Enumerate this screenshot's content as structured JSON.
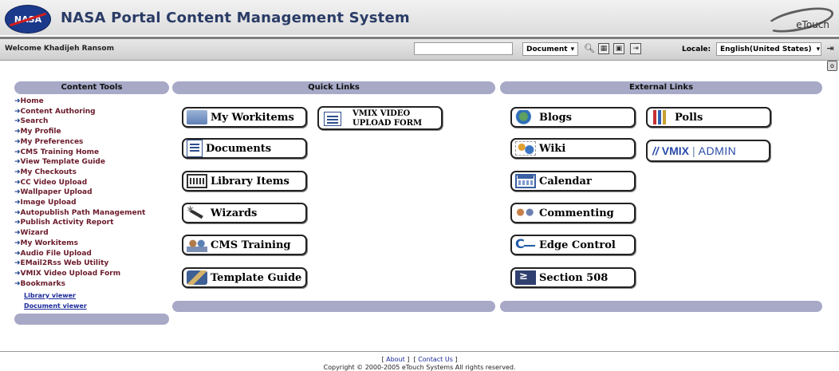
{
  "header": {
    "logo_text": "NASA",
    "title": "NASA Portal Content Management System",
    "vendor_logo": "eTouch"
  },
  "toolbar": {
    "welcome": "Welcome  Khadijeh Ransom",
    "search_value": "",
    "search_type": "Document",
    "locale_label": "Locale:",
    "locale_value": "English(United States)"
  },
  "content_tools": {
    "heading": "Content Tools",
    "items": [
      "Home",
      "Content Authoring",
      "Search",
      "My Profile",
      "My Preferences",
      "CMS Training Home",
      "View Template Guide",
      "My Checkouts",
      "CC Video Upload",
      "Wallpaper Upload",
      "Image Upload",
      "Autopublish Path Management",
      "Publish Activity Report",
      "Wizard",
      "My Workitems",
      "Audio File Upload",
      "EMail2Rss Web Utility",
      "VMIX Video Upload Form"
    ],
    "bookmarks_label": "Bookmarks",
    "bookmarks": [
      "Library viewer",
      "Document viewer"
    ]
  },
  "quick_links": {
    "heading": "Quick Links",
    "buttons": [
      "My Workitems",
      "Documents",
      "Library Items",
      "Wizards",
      "CMS Training",
      "Template Guide"
    ],
    "vmix_form_line1": "VMIX VIDEO",
    "vmix_form_line2": "UPLOAD FORM"
  },
  "external_links": {
    "heading": "External Links",
    "buttons": [
      "Blogs",
      "Wiki",
      "Calendar",
      "Commenting",
      "Edge Control",
      "Section 508",
      "Polls"
    ],
    "vmix_admin_vmix": "VMIX",
    "vmix_admin_sep": "|",
    "vmix_admin_admin": "ADMIN"
  },
  "footer": {
    "about": "About",
    "contact": "Contact Us",
    "copyright": "Copyright © 2000-2005 eTouch Systems All rights reserved."
  },
  "colors": {
    "panel_bar": "#a7a9c7",
    "link_maroon": "#6a1a2a",
    "arrow_blue": "#1a3c8a",
    "vmix_blue": "#2a4aa8"
  }
}
